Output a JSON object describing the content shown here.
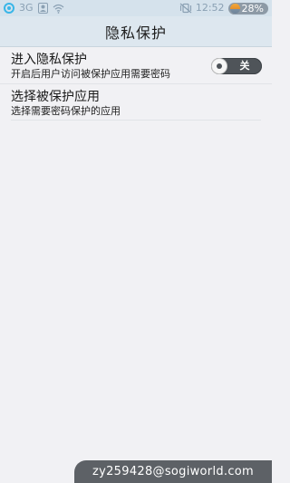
{
  "status_bar": {
    "network": "3G",
    "time": "12:52",
    "battery": "28%",
    "icons": {
      "signal": "signal-icon",
      "contacts": "contacts-icon",
      "wifi": "wifi-icon",
      "silent": "vibrate-off-icon",
      "battery": "battery-icon"
    }
  },
  "header": {
    "title": "隐私保护"
  },
  "settings": {
    "items": [
      {
        "label": "进入隐私保护",
        "description": "开启后用户访问被保护应用需要密码",
        "toggle": {
          "state": "off",
          "label": "关"
        }
      },
      {
        "label": "选择被保护应用",
        "description": "选择需要密码保护的应用"
      }
    ]
  },
  "watermark": {
    "text": "zy259428@sogiworld.com"
  },
  "colors": {
    "status_bar_bg": "#d5e2ec",
    "title_bar_bg": "#dde7ef",
    "page_bg": "#f1f1f4",
    "toggle_off": "#4f5459",
    "watermark_bg": "#5d6166"
  }
}
